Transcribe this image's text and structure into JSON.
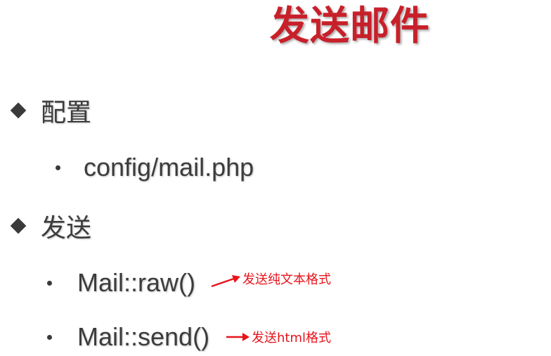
{
  "title": "发送邮件",
  "sections": [
    {
      "heading": "配置",
      "items": [
        "config/mail.php"
      ]
    },
    {
      "heading": "发送",
      "items": [
        "Mail::raw()",
        "Mail::send()"
      ]
    }
  ],
  "annotations": [
    "发送纯文本格式",
    "发送html格式"
  ],
  "colors": {
    "title": "#c8202a",
    "body_text": "#3c3c3c",
    "annotation": "#e8141c"
  }
}
